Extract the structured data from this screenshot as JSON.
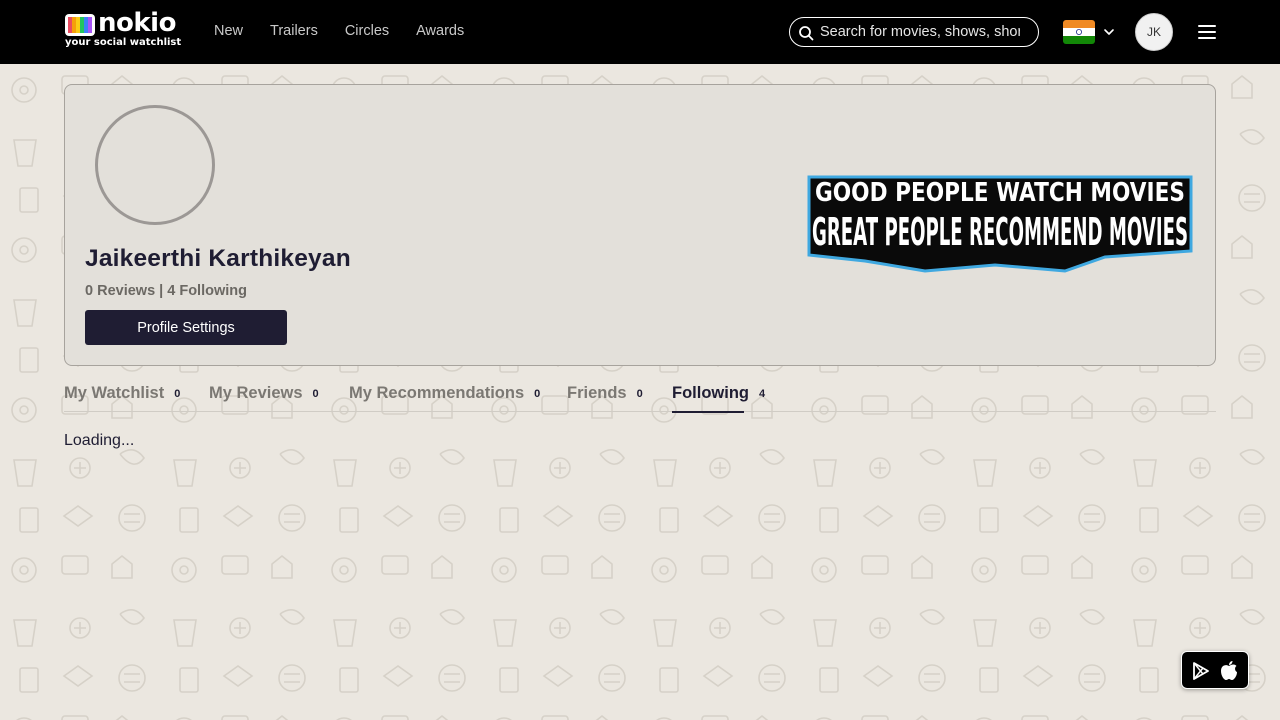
{
  "header": {
    "brand_name": "nokio",
    "brand_tagline": "your social watchlist",
    "nav": [
      "New",
      "Trailers",
      "Circles",
      "Awards"
    ],
    "search_placeholder": "Search for movies, shows, shorts",
    "country": "India",
    "user_initials": "JK"
  },
  "profile": {
    "name": "Jaikeerthi Karthikeyan",
    "stats": "0 Reviews | 4 Following",
    "settings_button": "Profile Settings",
    "banner_line1": "GOOD PEOPLE WATCH MOVIES",
    "banner_line2": "GREAT PEOPLE RECOMMEND MOVIES"
  },
  "tabs": [
    {
      "label": "My Watchlist",
      "count": "0"
    },
    {
      "label": "My Reviews",
      "count": "0"
    },
    {
      "label": "My Recommendations",
      "count": "0"
    },
    {
      "label": "Friends",
      "count": "0"
    },
    {
      "label": "Following",
      "count": "4",
      "active": true
    }
  ],
  "content": {
    "status_text": "Loading..."
  },
  "app_badge": {
    "icons": [
      "google-play-icon",
      "apple-icon"
    ]
  },
  "colors": {
    "header_bg": "#000000",
    "page_bg": "#ebe7e0",
    "primary_dark": "#1f1d33",
    "card_bg": "#e3e0da"
  }
}
